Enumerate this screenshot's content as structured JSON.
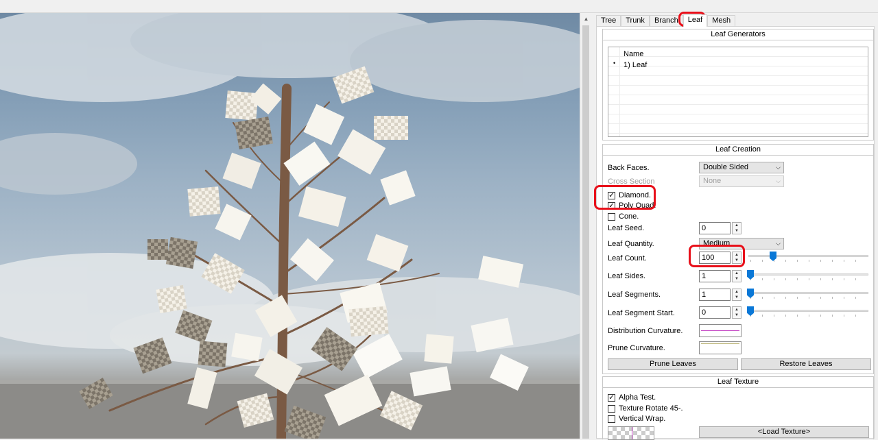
{
  "tabs": [
    {
      "label": "Tree"
    },
    {
      "label": "Trunk"
    },
    {
      "label": "Branch"
    },
    {
      "label": "Leaf"
    },
    {
      "label": "Mesh"
    }
  ],
  "generators": {
    "title": "Leaf Generators",
    "column": "Name",
    "items": [
      {
        "bullet": "•",
        "label": "1) Leaf"
      }
    ]
  },
  "creation": {
    "title": "Leaf Creation",
    "back_faces": {
      "label": "Back Faces.",
      "value": "Double Sided"
    },
    "cross_section": {
      "label": "Cross Section",
      "value": "None"
    },
    "diamond": {
      "label": "Diamond.",
      "checked": true
    },
    "poly_quad": {
      "label": "Poly Quad.",
      "checked": true
    },
    "cone": {
      "label": "Cone.",
      "checked": false
    },
    "leaf_seed": {
      "label": "Leaf Seed.",
      "value": "0"
    },
    "leaf_quantity": {
      "label": "Leaf Quantity.",
      "value": "Medium"
    },
    "leaf_count": {
      "label": "Leaf Count.",
      "value": "100",
      "slider_fraction": 0.2
    },
    "leaf_sides": {
      "label": "Leaf Sides.",
      "value": "1",
      "slider_fraction": 0.0
    },
    "leaf_segments": {
      "label": "Leaf Segments.",
      "value": "1",
      "slider_fraction": 0.0
    },
    "leaf_segment_start": {
      "label": "Leaf Segment Start.",
      "value": "0",
      "slider_fraction": 0.0
    },
    "distribution_curvature": {
      "label": "Distribution Curvature."
    },
    "prune_curvature": {
      "label": "Prune Curvature."
    },
    "prune_button": "Prune Leaves",
    "restore_button": "Restore Leaves"
  },
  "texture": {
    "title": "Leaf Texture",
    "alpha_test": {
      "label": "Alpha Test.",
      "checked": true
    },
    "texture_rotate": {
      "label": "Texture Rotate 45-.",
      "checked": false
    },
    "vertical_wrap": {
      "label": "Vertical Wrap.",
      "checked": false
    },
    "load_button": "<Load Texture>"
  },
  "colors": {
    "highlight": "#e8101a",
    "slider_knob": "#0a78d7"
  }
}
